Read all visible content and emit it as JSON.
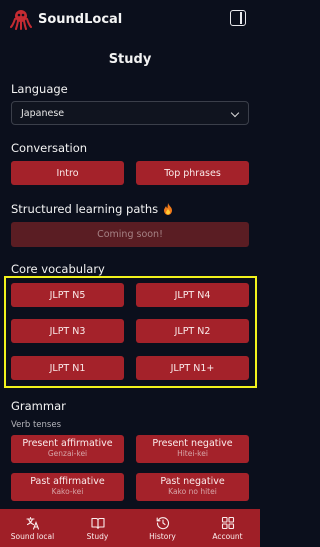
{
  "header": {
    "brand": "SoundLocal"
  },
  "page": {
    "title": "Study"
  },
  "language": {
    "label": "Language",
    "selected": "Japanese"
  },
  "conversation": {
    "label": "Conversation",
    "buttons": [
      "Intro",
      "Top phrases"
    ]
  },
  "paths": {
    "label": "Structured learning paths",
    "status": "Coming soon!"
  },
  "vocab": {
    "label": "Core vocabulary",
    "buttons": [
      "JLPT N5",
      "JLPT N4",
      "JLPT N3",
      "JLPT N2",
      "JLPT N1",
      "JLPT N1+"
    ]
  },
  "grammar": {
    "label": "Grammar",
    "sublabel": "Verb tenses",
    "tenses": [
      {
        "title": "Present affirmative",
        "sub": "Genzai-kei"
      },
      {
        "title": "Present negative",
        "sub": "Hitei-kei"
      },
      {
        "title": "Past affirmative",
        "sub": "Kako-kei"
      },
      {
        "title": "Past negative",
        "sub": "Kako no hitei"
      }
    ]
  },
  "nav": {
    "items": [
      "Sound local",
      "Study",
      "History",
      "Account"
    ]
  },
  "colors": {
    "background": "#0b0f1c",
    "accent": "#a4222a",
    "highlight": "#f2f21c"
  }
}
